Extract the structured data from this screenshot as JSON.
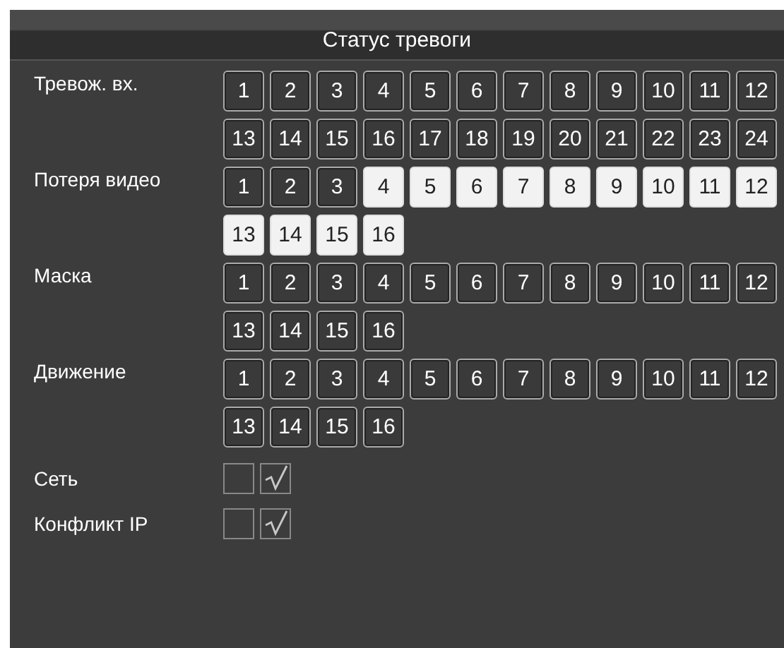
{
  "window": {
    "title": "Статус тревоги"
  },
  "groups": [
    {
      "label": "Тревож. вх.",
      "channels": [
        {
          "number": "1",
          "active": false
        },
        {
          "number": "2",
          "active": false
        },
        {
          "number": "3",
          "active": false
        },
        {
          "number": "4",
          "active": false
        },
        {
          "number": "5",
          "active": false
        },
        {
          "number": "6",
          "active": false
        },
        {
          "number": "7",
          "active": false
        },
        {
          "number": "8",
          "active": false
        },
        {
          "number": "9",
          "active": false
        },
        {
          "number": "10",
          "active": false
        },
        {
          "number": "11",
          "active": false
        },
        {
          "number": "12",
          "active": false
        },
        {
          "number": "13",
          "active": false
        },
        {
          "number": "14",
          "active": false
        },
        {
          "number": "15",
          "active": false
        },
        {
          "number": "16",
          "active": false
        },
        {
          "number": "17",
          "active": false
        },
        {
          "number": "18",
          "active": false
        },
        {
          "number": "19",
          "active": false
        },
        {
          "number": "20",
          "active": false
        },
        {
          "number": "21",
          "active": false
        },
        {
          "number": "22",
          "active": false
        },
        {
          "number": "23",
          "active": false
        },
        {
          "number": "24",
          "active": false
        }
      ]
    },
    {
      "label": "Потеря видео",
      "channels": [
        {
          "number": "1",
          "active": false
        },
        {
          "number": "2",
          "active": false
        },
        {
          "number": "3",
          "active": false
        },
        {
          "number": "4",
          "active": true
        },
        {
          "number": "5",
          "active": true
        },
        {
          "number": "6",
          "active": true
        },
        {
          "number": "7",
          "active": true
        },
        {
          "number": "8",
          "active": true
        },
        {
          "number": "9",
          "active": true
        },
        {
          "number": "10",
          "active": true
        },
        {
          "number": "11",
          "active": true
        },
        {
          "number": "12",
          "active": true
        },
        {
          "number": "13",
          "active": true
        },
        {
          "number": "14",
          "active": true
        },
        {
          "number": "15",
          "active": true
        },
        {
          "number": "16",
          "active": true
        }
      ]
    },
    {
      "label": "Маска",
      "channels": [
        {
          "number": "1",
          "active": false
        },
        {
          "number": "2",
          "active": false
        },
        {
          "number": "3",
          "active": false
        },
        {
          "number": "4",
          "active": false
        },
        {
          "number": "5",
          "active": false
        },
        {
          "number": "6",
          "active": false
        },
        {
          "number": "7",
          "active": false
        },
        {
          "number": "8",
          "active": false
        },
        {
          "number": "9",
          "active": false
        },
        {
          "number": "10",
          "active": false
        },
        {
          "number": "11",
          "active": false
        },
        {
          "number": "12",
          "active": false
        },
        {
          "number": "13",
          "active": false
        },
        {
          "number": "14",
          "active": false
        },
        {
          "number": "15",
          "active": false
        },
        {
          "number": "16",
          "active": false
        }
      ]
    },
    {
      "label": "Движение",
      "channels": [
        {
          "number": "1",
          "active": false
        },
        {
          "number": "2",
          "active": false
        },
        {
          "number": "3",
          "active": false
        },
        {
          "number": "4",
          "active": false
        },
        {
          "number": "5",
          "active": false
        },
        {
          "number": "6",
          "active": false
        },
        {
          "number": "7",
          "active": false
        },
        {
          "number": "8",
          "active": false
        },
        {
          "number": "9",
          "active": false
        },
        {
          "number": "10",
          "active": false
        },
        {
          "number": "11",
          "active": false
        },
        {
          "number": "12",
          "active": false
        },
        {
          "number": "13",
          "active": false
        },
        {
          "number": "14",
          "active": false
        },
        {
          "number": "15",
          "active": false
        },
        {
          "number": "16",
          "active": false
        }
      ]
    }
  ],
  "flags": [
    {
      "label": "Сеть",
      "indicators": [
        {
          "checked": false
        },
        {
          "checked": true
        }
      ]
    },
    {
      "label": "Конфликт IP",
      "indicators": [
        {
          "checked": false
        },
        {
          "checked": true
        }
      ]
    }
  ]
}
